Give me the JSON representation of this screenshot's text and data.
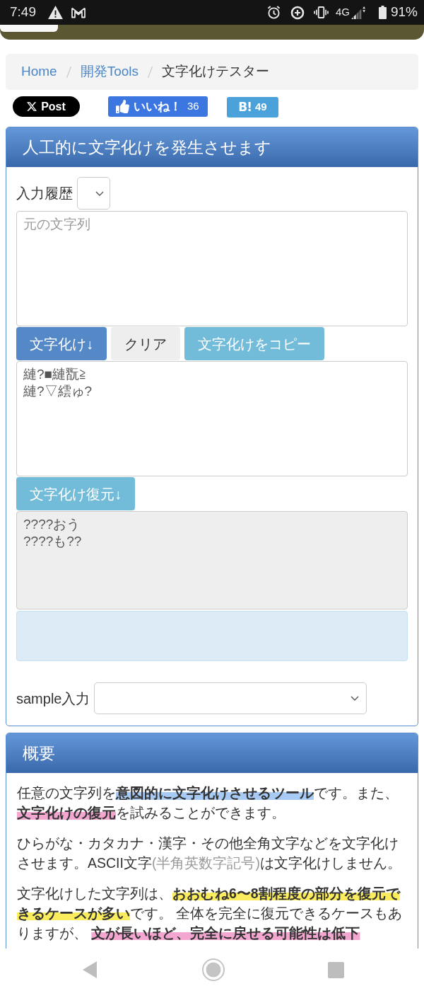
{
  "status_bar": {
    "time": "7:49",
    "network": "4G",
    "battery": "91%"
  },
  "breadcrumb": [
    {
      "label": "Home",
      "current": false
    },
    {
      "label": "開発Tools",
      "current": false
    },
    {
      "label": "文字化けテスター",
      "current": true
    }
  ],
  "share_buttons": [
    {
      "kind": "x",
      "label": "Post"
    },
    {
      "kind": "like",
      "label": "いいね！",
      "count": "36"
    },
    {
      "kind": "hatena",
      "label": "B!",
      "count": "49"
    }
  ],
  "generator": {
    "title": "人工的に文字化けを発生させます",
    "history_label": "入力履歴",
    "source": {
      "placeholder": "元の文字列",
      "readonly": false
    },
    "actions": [
      {
        "label": "文字化け↓",
        "kind": "primary"
      },
      {
        "label": "クリア",
        "kind": "default"
      },
      {
        "label": "文字化けをコピー",
        "kind": "info"
      }
    ],
    "garbled": {
      "value": "縺?■縺翫≧\n縺?▽繧ゅ?",
      "readonly": false
    },
    "restore_button": {
      "label": "文字化け復元↓",
      "kind": "info"
    },
    "restored": {
      "value": "????おう\n????も??",
      "readonly": true
    },
    "sample_label": "sample入力"
  },
  "overview": {
    "title": "概要",
    "paragraphs": [
      {
        "segments": [
          {
            "text": "任意の文字列を",
            "bold": false
          },
          {
            "text": "意図的に文字化けさせるツール",
            "bold": true,
            "color": "#a8cbf6"
          },
          {
            "text": "です。また、",
            "bold": false
          },
          {
            "text": "文字化けの復元",
            "bold": true,
            "color": "#f3a6cf"
          },
          {
            "text": "を試みることができます。",
            "bold": false
          }
        ]
      },
      {
        "segments": [
          {
            "text": "ひらがな・カタカナ・漢字・その他全角文字などを文字化けさせます。ASCII文字",
            "bold": false
          },
          {
            "text": "(半角英数字記号)",
            "bold": false,
            "muted": true
          },
          {
            "text": "は文字化けしません。",
            "bold": false
          }
        ]
      },
      {
        "segments": [
          {
            "text": "文字化けした文字列は、",
            "bold": false
          },
          {
            "text": "おおむね6〜8割程度の部分を復元できるケースが多い",
            "bold": true,
            "color": "#fbec5d"
          },
          {
            "text": "です。 全体を完全に復元できるケースもありますが、 ",
            "bold": false
          },
          {
            "text": "文が長いほど、完全に戻せる可能性は低下",
            "bold": true,
            "color": "#f3a6cf"
          }
        ]
      }
    ]
  }
}
